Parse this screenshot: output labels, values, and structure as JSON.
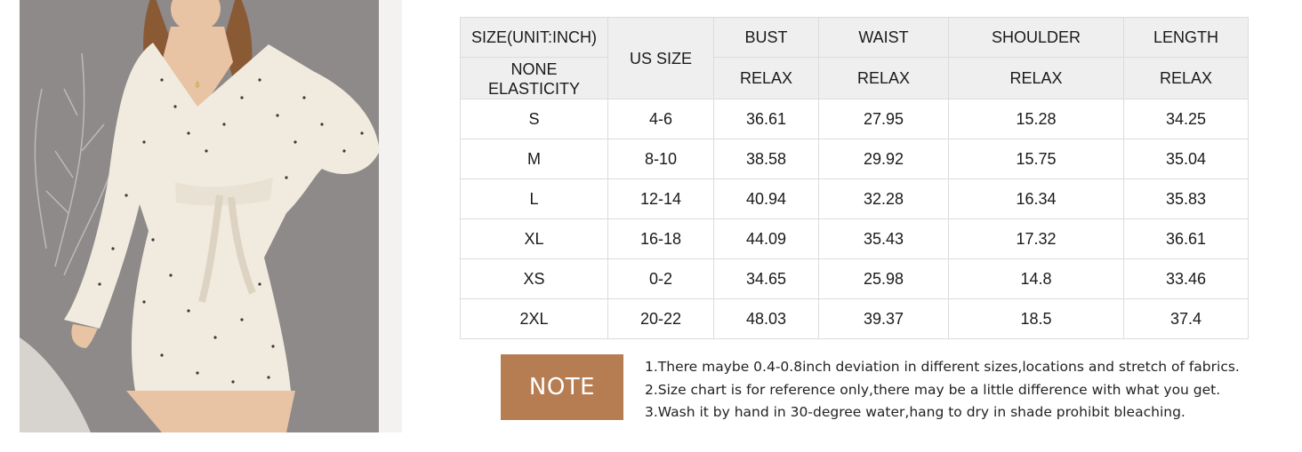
{
  "table": {
    "header_row1": {
      "size": "SIZE(UNIT:INCH)",
      "us_size": "US SIZE",
      "bust": "BUST",
      "waist": "WAIST",
      "shoulder": "SHOULDER",
      "length": "LENGTH"
    },
    "header_row2": {
      "elasticity_line1": "NONE",
      "elasticity_line2": "ELASTICITY",
      "bust": "RELAX",
      "waist": "RELAX",
      "shoulder": "RELAX",
      "length": "RELAX"
    },
    "rows": [
      {
        "size": "S",
        "us": "4-6",
        "bust": "36.61",
        "waist": "27.95",
        "shoulder": "15.28",
        "length": "34.25"
      },
      {
        "size": "M",
        "us": "8-10",
        "bust": "38.58",
        "waist": "29.92",
        "shoulder": "15.75",
        "length": "35.04"
      },
      {
        "size": "L",
        "us": "12-14",
        "bust": "40.94",
        "waist": "32.28",
        "shoulder": "16.34",
        "length": "35.83"
      },
      {
        "size": "XL",
        "us": "16-18",
        "bust": "44.09",
        "waist": "35.43",
        "shoulder": "17.32",
        "length": "36.61"
      },
      {
        "size": "XS",
        "us": "0-2",
        "bust": "34.65",
        "waist": "25.98",
        "shoulder": "14.8",
        "length": "33.46"
      },
      {
        "size": "2XL",
        "us": "20-22",
        "bust": "48.03",
        "waist": "39.37",
        "shoulder": "18.5",
        "length": "37.4"
      }
    ]
  },
  "note": {
    "label": "NOTE",
    "lines": [
      "1.There maybe 0.4-0.8inch deviation in different sizes,locations and stretch of fabrics.",
      "2.Size chart is for reference only,there may be a little difference with what you get.",
      "3.Wash it by hand in 30-degree water,hang to dry in shade prohibit bleaching."
    ]
  },
  "colors": {
    "note_badge": "#b67d53",
    "header_bg": "#efefef",
    "border": "#dcdcdc"
  }
}
